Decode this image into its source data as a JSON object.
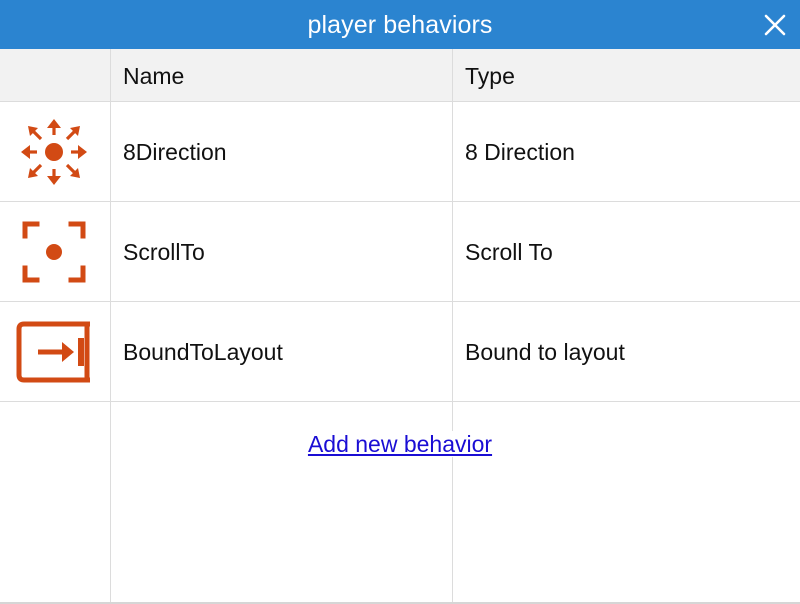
{
  "window": {
    "title": "player behaviors",
    "close_icon": "close-icon",
    "titlebar_color": "#2b84d0"
  },
  "table": {
    "columns": [
      "",
      "Name",
      "Type"
    ],
    "rows": [
      {
        "icon": "eight-direction-icon",
        "name": "8Direction",
        "type": "8 Direction"
      },
      {
        "icon": "scroll-to-icon",
        "name": "ScrollTo",
        "type": "Scroll To"
      },
      {
        "icon": "bound-to-layout-icon",
        "name": "BoundToLayout",
        "type": "Bound to layout"
      }
    ],
    "icon_color": "#d24a14"
  },
  "actions": {
    "add_new_behavior": "Add new behavior"
  }
}
